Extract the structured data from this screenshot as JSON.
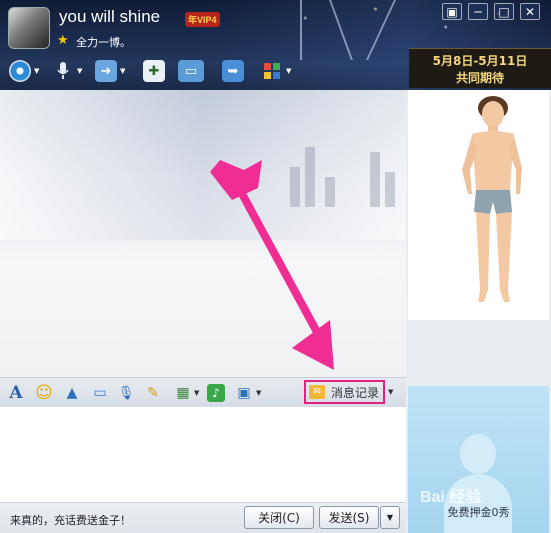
{
  "contact": {
    "name": "you will shine",
    "vip_badge": "年VIP4",
    "signature": "全力一博。"
  },
  "window_controls": [
    "▣",
    "─",
    "□",
    "✕"
  ],
  "promo": {
    "date_range": "5月8日-5月11日",
    "subtitle": "共同期待"
  },
  "top_toolbar": {
    "items": [
      {
        "icon": "webcam-icon"
      },
      {
        "icon": "microphone-icon"
      },
      {
        "icon": "file-transfer-icon"
      },
      {
        "icon": "add-chat-icon"
      },
      {
        "icon": "remote-desktop-icon"
      },
      {
        "icon": "share-screen-icon"
      },
      {
        "icon": "apps-grid-icon"
      }
    ]
  },
  "input_toolbar": {
    "items": [
      {
        "icon": "font-icon",
        "glyph": "A"
      },
      {
        "icon": "emoji-icon",
        "glyph": "☺"
      },
      {
        "icon": "shake-icon",
        "glyph": "▲"
      },
      {
        "icon": "gif-icon",
        "glyph": "▭"
      },
      {
        "icon": "voice-message-icon",
        "glyph": "🎙"
      },
      {
        "icon": "note-icon",
        "glyph": "✎"
      },
      {
        "icon": "screenshot-icon",
        "glyph": "▦"
      },
      {
        "icon": "music-icon",
        "glyph": "♪"
      },
      {
        "icon": "monitor-icon",
        "glyph": "▣"
      }
    ],
    "history_label": "消息记录"
  },
  "status_text": "来真的，充话费送金子！",
  "buttons": {
    "close": "关闭(C)",
    "send": "发送(S)"
  },
  "show_panel": {
    "label": "免费押金0秀"
  },
  "watermark": "Bai 经验",
  "colors": {
    "highlight": "#e0237f",
    "header_bg": "#1b2c4f",
    "promo_text": "#f5d580"
  }
}
